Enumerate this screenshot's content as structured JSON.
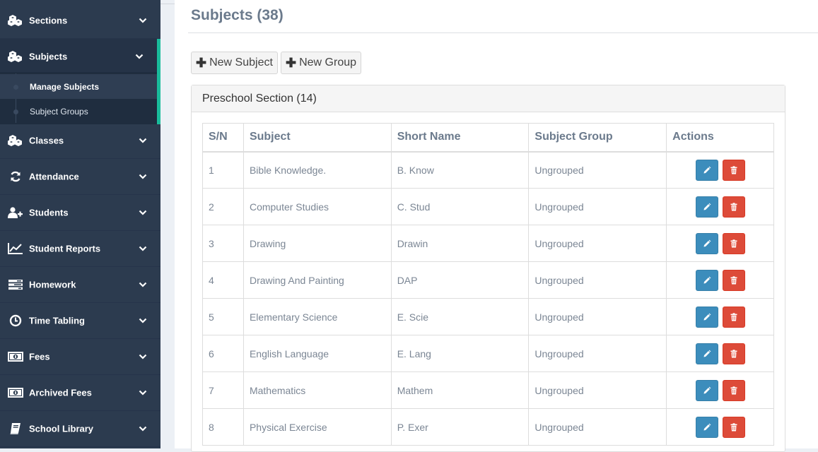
{
  "sidebar": {
    "items": [
      {
        "label": "Sections",
        "icon": "cubes-icon"
      },
      {
        "label": "Subjects",
        "icon": "cubes-icon"
      },
      {
        "label": "Classes",
        "icon": "cubes-icon"
      },
      {
        "label": "Attendance",
        "icon": "refresh-icon"
      },
      {
        "label": "Students",
        "icon": "user-plus-icon"
      },
      {
        "label": "Student Reports",
        "icon": "line-chart-icon"
      },
      {
        "label": "Homework",
        "icon": "tasks-icon"
      },
      {
        "label": "Time Tabling",
        "icon": "clock-icon"
      },
      {
        "label": "Fees",
        "icon": "money-icon"
      },
      {
        "label": "Archived Fees",
        "icon": "money-icon"
      },
      {
        "label": "School Library",
        "icon": "book-icon"
      }
    ],
    "subjects_submenu": [
      {
        "label": "Manage Subjects",
        "active": true
      },
      {
        "label": "Subject Groups",
        "active": false
      }
    ],
    "accent_color": "#1abc9c",
    "background_color": "#2c3b4f"
  },
  "header": {
    "title": "Subjects (38)"
  },
  "toolbar": {
    "new_subject_label": "New Subject",
    "new_group_label": "New Group"
  },
  "panel": {
    "title": "Preschool Section (14)"
  },
  "table": {
    "columns": [
      "S/N",
      "Subject",
      "Short Name",
      "Subject Group",
      "Actions"
    ],
    "rows": [
      {
        "sn": "1",
        "subject": "Bible Knowledge.",
        "short": "B. Know",
        "group": "Ungrouped"
      },
      {
        "sn": "2",
        "subject": "Computer Studies",
        "short": "C. Stud",
        "group": "Ungrouped"
      },
      {
        "sn": "3",
        "subject": "Drawing",
        "short": "Drawin",
        "group": "Ungrouped"
      },
      {
        "sn": "4",
        "subject": "Drawing And Painting",
        "short": "DAP",
        "group": "Ungrouped"
      },
      {
        "sn": "5",
        "subject": "Elementary Science",
        "short": "E. Scie",
        "group": "Ungrouped"
      },
      {
        "sn": "6",
        "subject": "English Language",
        "short": "E. Lang",
        "group": "Ungrouped"
      },
      {
        "sn": "7",
        "subject": "Mathematics",
        "short": "Mathem",
        "group": "Ungrouped"
      },
      {
        "sn": "8",
        "subject": "Physical Exercise",
        "short": "P. Exer",
        "group": "Ungrouped"
      }
    ],
    "edit_color": "#3c8dbc",
    "delete_color": "#dd4b39"
  }
}
